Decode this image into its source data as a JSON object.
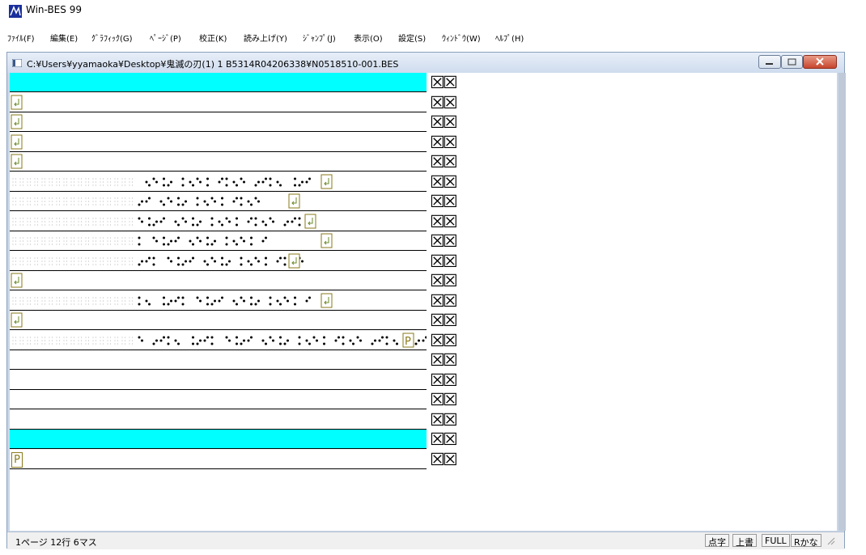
{
  "app": {
    "title": "Win-BES 99"
  },
  "menu": [
    "ﾌｧｲﾙ(F)",
    "編集(E)",
    "ｸﾞﾗﾌｨｯｸ(G)",
    "ﾍﾟｰｼﾞ(P)",
    "校正(K)",
    "読み上げ(Y)",
    "ｼﾞｬﾝﾌﾟ(J)",
    "表示(O)",
    "設定(S)",
    "ｳｨﾝﾄﾞｳ(W)",
    "ﾍﾙﾌﾟ(H)"
  ],
  "document": {
    "path": "C:¥Users¥yyamaoka¥Desktop¥鬼滅の刃(1) 1 B5314R04206338¥N0518510-001.BES"
  },
  "rows": [
    {
      "type": "highlight"
    },
    {
      "type": "return"
    },
    {
      "type": "return"
    },
    {
      "type": "return"
    },
    {
      "type": "return"
    },
    {
      "type": "braille",
      "text": "⠀⠀⠀⠀⠀⠀⠀⠀⠀⠀⠀⠀⠀⠀⠀⠀⠀⠀⠀⠀⠀⠀⠀⠀⠀⠀⠀⠀⠀⠀"
    },
    {
      "type": "braille"
    },
    {
      "type": "braille"
    },
    {
      "type": "braille"
    },
    {
      "type": "braille"
    },
    {
      "type": "return"
    },
    {
      "type": "braille"
    },
    {
      "type": "return"
    },
    {
      "type": "braille-p"
    },
    {
      "type": "blank"
    },
    {
      "type": "blank"
    },
    {
      "type": "blank"
    },
    {
      "type": "blank"
    },
    {
      "type": "highlight"
    },
    {
      "type": "page-mark",
      "mark": "P"
    }
  ],
  "row_end_marker": "XX",
  "status": {
    "position": "1ページ 12行 6マス",
    "mode": "点字",
    "insert": "上書",
    "full": "FULL",
    "kana": "Rかな"
  }
}
